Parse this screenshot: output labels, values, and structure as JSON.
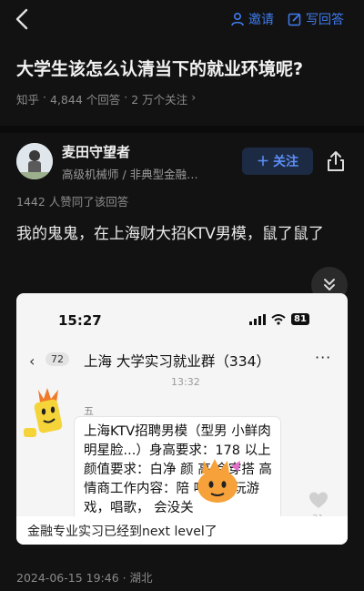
{
  "nav": {
    "invite": "邀请",
    "write_answer": "写回答"
  },
  "question": {
    "title": "大学生该怎么认清当下的就业环境呢?",
    "source": "知乎",
    "answer_count": "4,844 个回答",
    "follower_count": "2 万个关注"
  },
  "author": {
    "name": "麦田守望者",
    "bio": "高级机械师 / 非典型金融…",
    "follow_label": "关注"
  },
  "answer": {
    "approval": "1442 人赞同了该回答",
    "text": "我的鬼鬼，在上海财大招KTV男模，鼠了鼠了",
    "post_time": "2024-06-15 19:46 · 湖北"
  },
  "screenshot": {
    "status_time": "15:27",
    "battery": "81",
    "unread_count": "72",
    "chat_title": "上海    大学实习就业群（334）",
    "chat_time": "13:32",
    "sender_name": "五",
    "message": "上海KTV招聘男模（型男 小鲜肉 明星脸...）身高要求：178 以上颜值要求：白净 颜   高 会穿搭 高情商工作内容：陪   喝酒，玩游戏，唱歌，   会没关",
    "like_count": "31",
    "caption": "金融专业实习已经到next level了"
  },
  "colors": {
    "accent": "#3f7cf0",
    "background": "#121212"
  },
  "icons": {
    "back": "chevron-left-icon",
    "invite": "person-icon",
    "write": "edit-icon",
    "share": "share-icon",
    "expand": "chevron-double-down-icon",
    "like": "heart-icon"
  }
}
